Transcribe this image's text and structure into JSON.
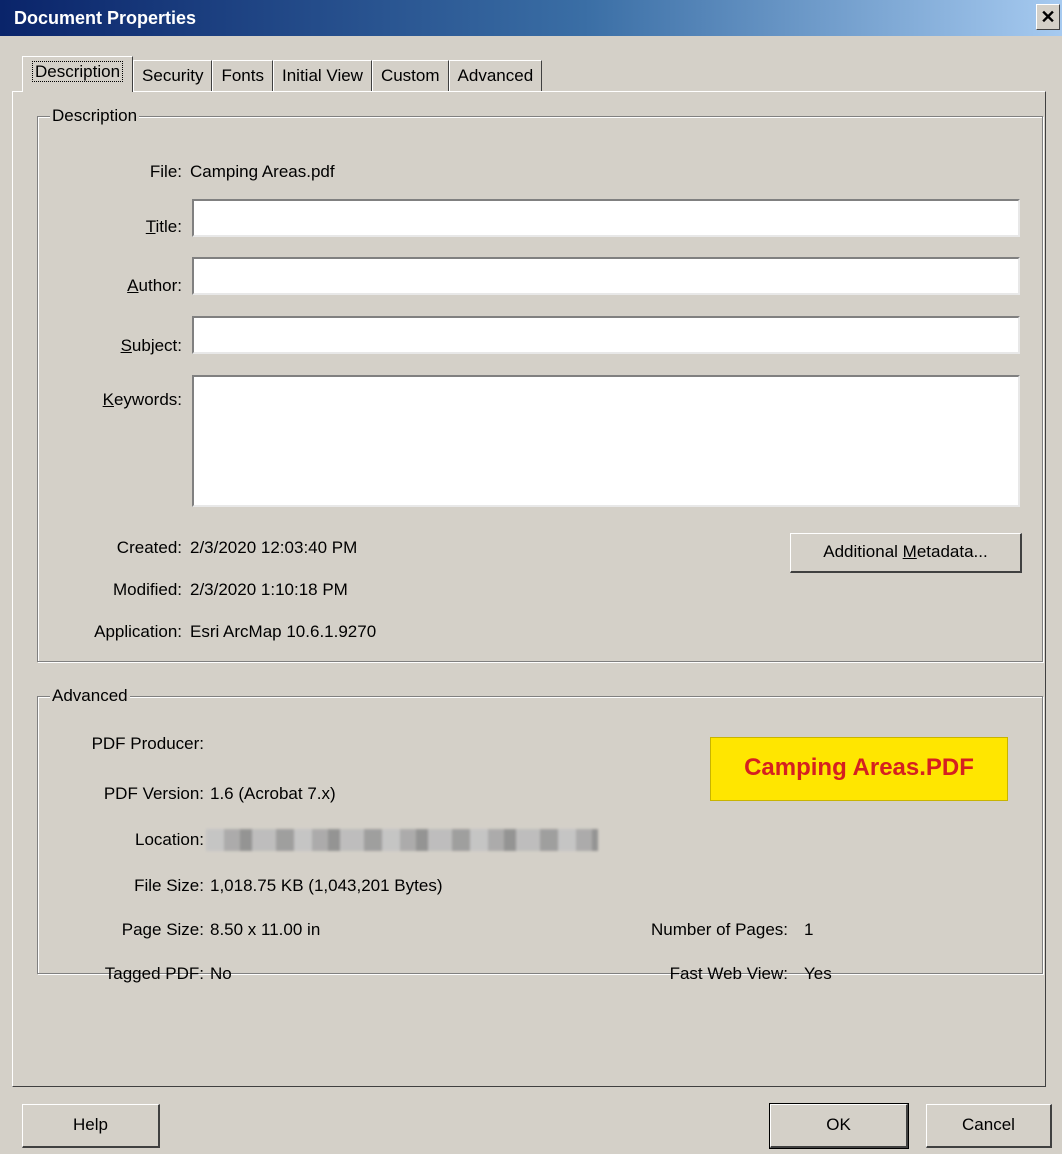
{
  "window": {
    "title": "Document Properties",
    "close_glyph": "✕"
  },
  "tabs": [
    {
      "label": "Description"
    },
    {
      "label": "Security"
    },
    {
      "label": "Fonts"
    },
    {
      "label": "Initial View"
    },
    {
      "label": "Custom"
    },
    {
      "label": "Advanced"
    }
  ],
  "description": {
    "group_title": "Description",
    "file_label": "File:",
    "file_value": "Camping Areas.pdf",
    "title_label_mnemonic": "T",
    "title_label_rest": "itle:",
    "title_value": "",
    "author_label_mnemonic": "A",
    "author_label_rest": "uthor:",
    "author_value": "",
    "subject_label_mnemonic": "S",
    "subject_label_rest": "ubject:",
    "subject_value": "",
    "keywords_label_mnemonic": "K",
    "keywords_label_rest": "eywords:",
    "keywords_value": "",
    "created_label": "Created:",
    "created_value": "2/3/2020 12:03:40 PM",
    "modified_label": "Modified:",
    "modified_value": "2/3/2020 1:10:18 PM",
    "application_label": "Application:",
    "application_value": "Esri ArcMap 10.6.1.9270",
    "metadata_button_pre": "Additional ",
    "metadata_button_mnemonic": "M",
    "metadata_button_post": "etadata..."
  },
  "advanced": {
    "group_title": "Advanced",
    "producer_label": "PDF Producer:",
    "producer_value": "",
    "version_label": "PDF Version:",
    "version_value": "1.6 (Acrobat 7.x)",
    "location_label": "Location:",
    "filesize_label": "File Size:",
    "filesize_value": "1,018.75 KB (1,043,201 Bytes)",
    "pagesize_label": "Page Size:",
    "pagesize_value": "8.50 x 11.00 in",
    "numpages_label": "Number of Pages:",
    "numpages_value": "1",
    "tagged_label": "Tagged PDF:",
    "tagged_value": "No",
    "fastweb_label": "Fast Web View:",
    "fastweb_value": "Yes",
    "overlay_badge": "Camping Areas.PDF"
  },
  "footer": {
    "help": "Help",
    "ok": "OK",
    "cancel": "Cancel"
  },
  "colors": {
    "dialog_bg": "#d4d0c8",
    "titlebar": "#0a246a",
    "badge_bg": "#ffe600",
    "badge_text": "#d52020"
  }
}
